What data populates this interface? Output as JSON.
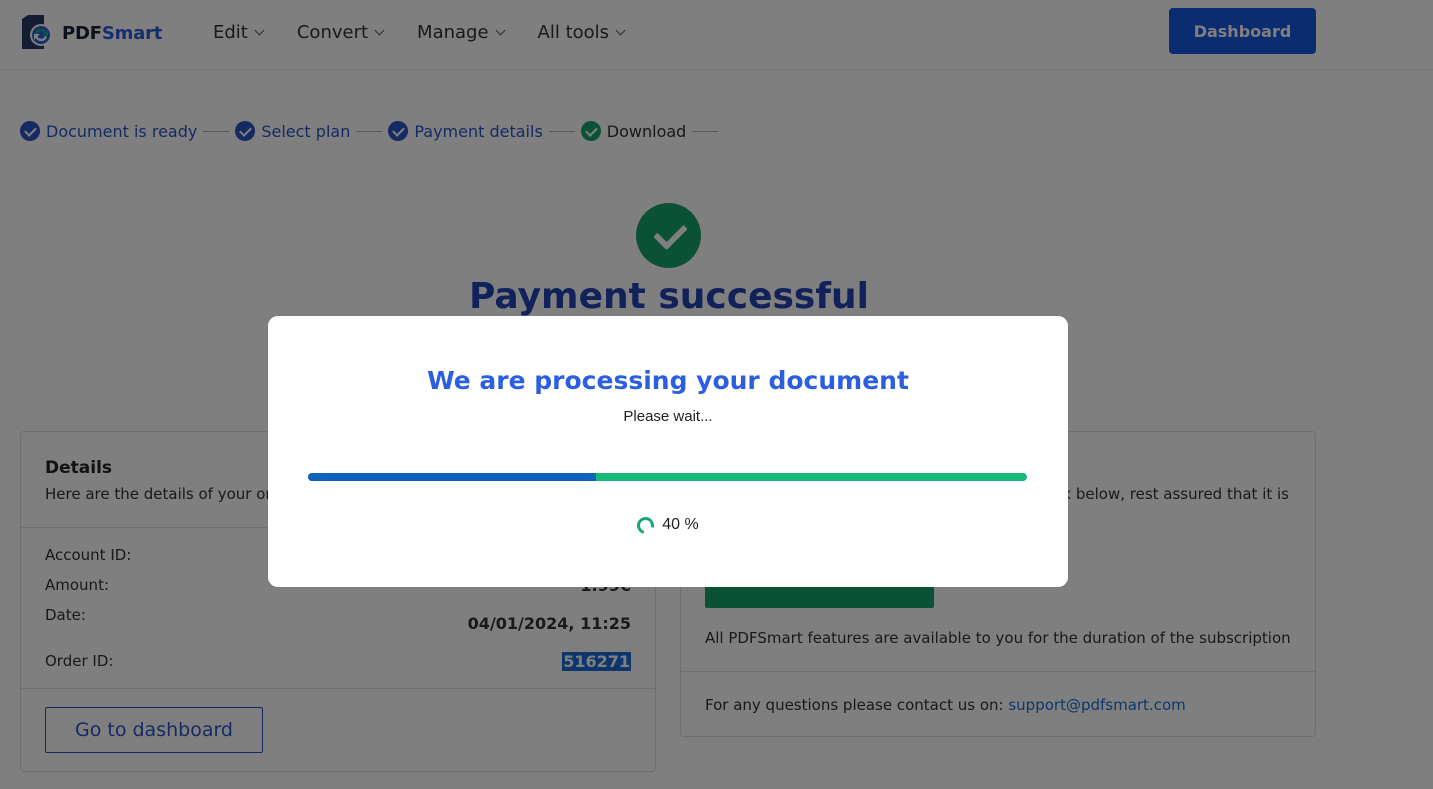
{
  "header": {
    "logo_prefix": "PDF",
    "logo_suffix": "Smart",
    "nav": [
      {
        "label": "Edit"
      },
      {
        "label": "Convert"
      },
      {
        "label": "Manage"
      },
      {
        "label": "All tools"
      }
    ],
    "dashboard_label": "Dashboard"
  },
  "stepper": {
    "steps": [
      {
        "label": "Document is ready"
      },
      {
        "label": "Select plan"
      },
      {
        "label": "Payment details"
      },
      {
        "label": "Download"
      }
    ]
  },
  "success": {
    "title": "Payment successful"
  },
  "details": {
    "title": "Details",
    "subtitle": "Here are the details of your orc",
    "account_label": "Account ID:",
    "amount_label": "Amount:",
    "amount_value": "1.99€",
    "date_label": "Date:",
    "date_value": "04/01/2024, 11:25",
    "order_label": "Order ID:",
    "order_value": "516271",
    "goto_label": "Go to dashboard"
  },
  "right_card": {
    "subtitle": "nk below, rest assured that it is",
    "features": "All PDFSmart features are available to you for the duration of the subscription",
    "contact_text": "For any questions please contact us on: ",
    "contact_email": "support@pdfsmart.com"
  },
  "modal": {
    "title": "We are processing your document",
    "subtitle": "Please wait...",
    "progress_percent": 40,
    "progress_label": "40 %"
  },
  "colors": {
    "brand_blue": "#1458e0",
    "step_blue": "#2b55c7",
    "success_green": "#17a36a",
    "progress_blue": "#0f63b8",
    "progress_green": "#16b97a"
  }
}
